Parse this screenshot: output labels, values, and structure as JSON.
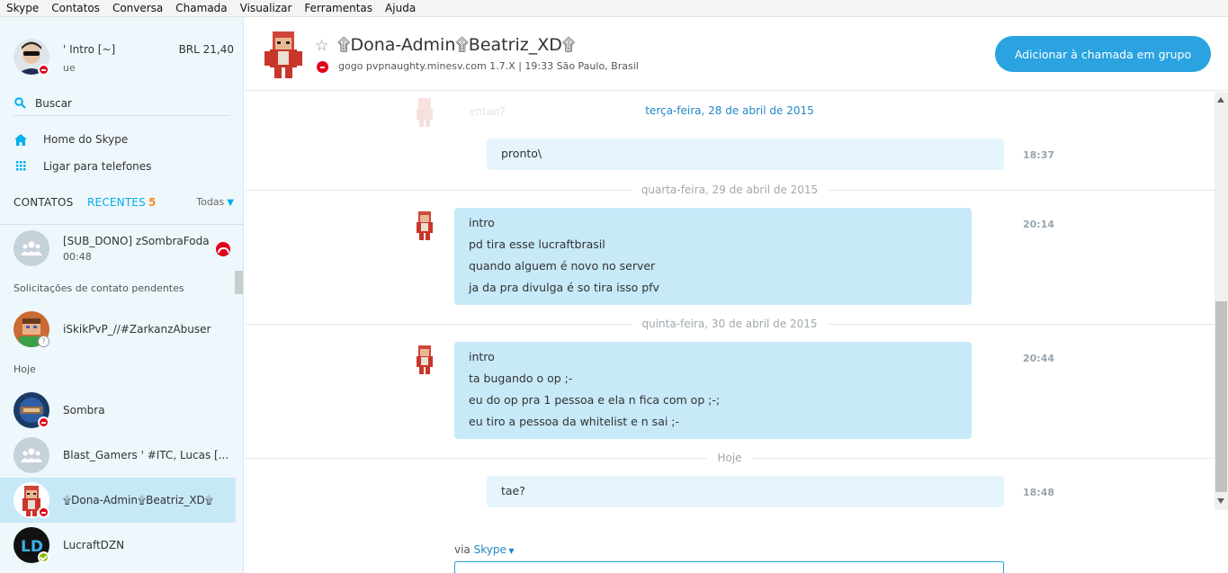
{
  "menu": [
    "Skype",
    "Contatos",
    "Conversa",
    "Chamada",
    "Visualizar",
    "Ferramentas",
    "Ajuda"
  ],
  "profile": {
    "name": "' Intro [~]",
    "mood": "ue",
    "credit": "BRL 21,40"
  },
  "search": {
    "label": "Buscar"
  },
  "nav": {
    "home": "Home do Skype",
    "phones": "Ligar para telefones"
  },
  "tabs": {
    "contatos": "CONTATOS",
    "recentes": "RECENTES",
    "recentes_count": "5",
    "filter": "Todas"
  },
  "recents": {
    "active_call": {
      "name": "[SUB_DONO] zSombraFoda",
      "duration": "00:48"
    },
    "pending_label": "Solicitações de contato pendentes",
    "pending": {
      "name": "iSkikPvP_//#ZarkanzAbuser"
    },
    "today_label": "Hoje",
    "items": [
      {
        "name": "Sombra"
      },
      {
        "name": "Blast_Gamers ' #ITC, Lucas [..."
      },
      {
        "name": "۩Dona-Admin۩Beatriz_XD۩"
      },
      {
        "name": "LucraftDZN"
      }
    ]
  },
  "chat": {
    "title": "۩Dona-Admin۩Beatriz_XD۩",
    "mood": "gogo  pvpnaughty.minesv.com 1.7.X  |  19:33 São Paulo, Brasil",
    "call_button": "Adicionar à chamada em grupo",
    "faded_text": "entao?",
    "dates": {
      "d1": "terça-feira, 28 de abril de 2015",
      "d2": "quarta-feira, 29 de abril de 2015",
      "d3": "quinta-feira, 30 de abril de 2015",
      "d4": "Hoje"
    },
    "messages": [
      {
        "time": "18:37",
        "lines": [
          "pronto\\"
        ]
      },
      {
        "time": "20:14",
        "lines": [
          "intro",
          "pd tira esse lucraftbrasil",
          "quando alguem é novo no server",
          "ja da pra divulga é so tira isso pfv"
        ]
      },
      {
        "time": "20:44",
        "lines": [
          "intro",
          "ta bugando o op ;-",
          "eu do op pra  1 pessoa e ela  n fica com op ;-;",
          "eu tiro a pessoa da whitelist e n sai ;-"
        ]
      },
      {
        "time": "18:48",
        "lines": [
          "tae?"
        ]
      }
    ],
    "via_label": "via",
    "via_link": "Skype"
  },
  "colors": {
    "accent": "#00aff0",
    "button": "#2aa3e0",
    "bubble_in": "#c7e9f8",
    "bubble_out": "#e6f5fc",
    "busy": "#e2001a",
    "online": "#7fba00"
  }
}
